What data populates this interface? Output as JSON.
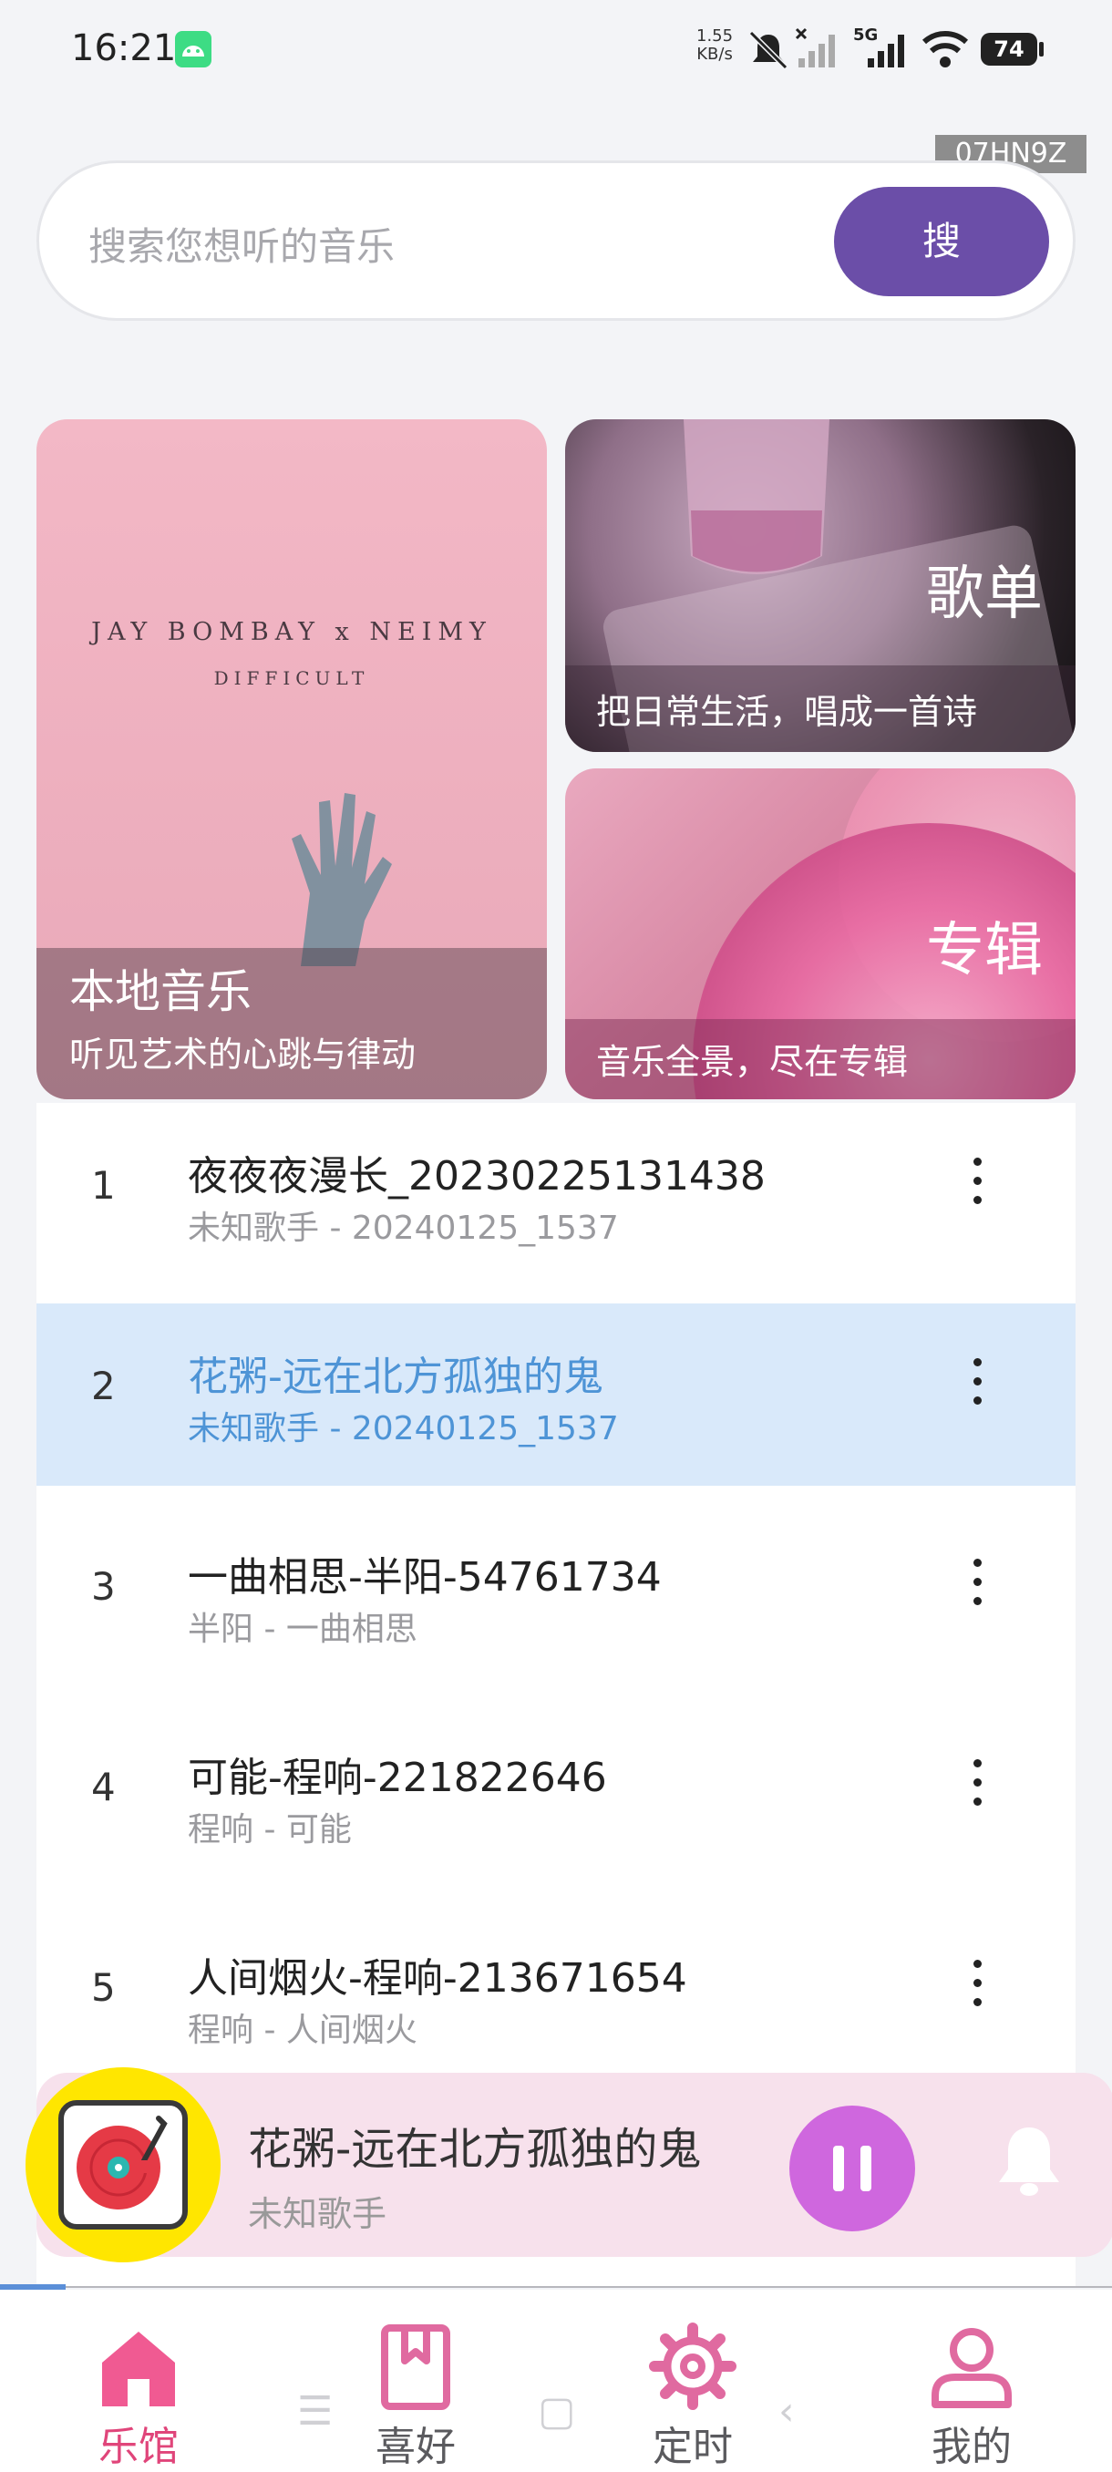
{
  "status_bar": {
    "time": "16:21",
    "net_speed_value": "1.55",
    "net_speed_unit": "KB/s",
    "network_label": "5G",
    "battery": "74",
    "icons": [
      "android-icon",
      "mute-icon",
      "no-signal-icon",
      "signal-icon",
      "wifi-icon",
      "battery-icon"
    ]
  },
  "watermark": "07HN9Z",
  "search": {
    "placeholder": "搜索您想听的音乐",
    "button_label": "搜"
  },
  "cards": {
    "local": {
      "title": "本地音乐",
      "subtitle": "听见艺术的心跳与律动",
      "cover_line1": "JAY BOMBAY x NEIMY",
      "cover_line2": "DIFFICULT"
    },
    "playlist": {
      "title": "歌单",
      "subtitle": "把日常生活，唱成一首诗"
    },
    "album": {
      "title": "专辑",
      "subtitle": "音乐全景，尽在专辑"
    }
  },
  "songs": [
    {
      "num": "1",
      "title": "夜夜夜漫长_20230225131438",
      "sub": "未知歌手 - 20240125_1537",
      "active": false
    },
    {
      "num": "2",
      "title": "花粥-远在北方孤独的鬼",
      "sub": "未知歌手 - 20240125_1537",
      "active": true
    },
    {
      "num": "3",
      "title": "一曲相思-半阳-54761734",
      "sub": "半阳 - 一曲相思",
      "active": false
    },
    {
      "num": "4",
      "title": "可能-程响-221822646",
      "sub": "程响 - 可能",
      "active": false
    },
    {
      "num": "5",
      "title": "人间烟火-程响-213671654",
      "sub": "程响 - 人间烟火",
      "active": false
    }
  ],
  "player": {
    "title": "花粥-远在北方孤独的鬼",
    "artist": "未知歌手",
    "state": "playing",
    "progress": 0.06
  },
  "nav": {
    "items": [
      {
        "label": "乐馆",
        "icon": "home-icon",
        "active": true
      },
      {
        "label": "喜好",
        "icon": "bookmark-icon",
        "active": false
      },
      {
        "label": "定时",
        "icon": "gear-icon",
        "active": false
      },
      {
        "label": "我的",
        "icon": "user-icon",
        "active": false
      }
    ]
  },
  "colors": {
    "accent": "#6b4ea8",
    "active_song": "#4e94d6",
    "active_row_bg": "#d9e9fa",
    "nav_active": "#e0457a",
    "pause_button": "#cf67de"
  }
}
